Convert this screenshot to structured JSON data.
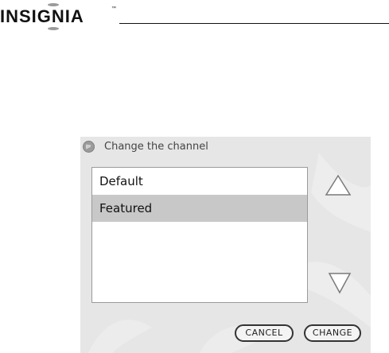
{
  "header": {
    "brand": "INSIGNIA",
    "trademark": "™"
  },
  "dialog": {
    "title": "Change the channel",
    "icon": "globe-icon",
    "channels": [
      {
        "label": "Default",
        "selected": false
      },
      {
        "label": "Featured",
        "selected": true
      }
    ],
    "scroll_up_icon": "triangle-up-icon",
    "scroll_down_icon": "triangle-down-icon",
    "cancel_label": "CANCEL",
    "change_label": "CHANGE"
  },
  "colors": {
    "dialog_bg": "#e6e6e6",
    "selected_row": "#c8c8c8",
    "list_bg": "#ffffff"
  }
}
